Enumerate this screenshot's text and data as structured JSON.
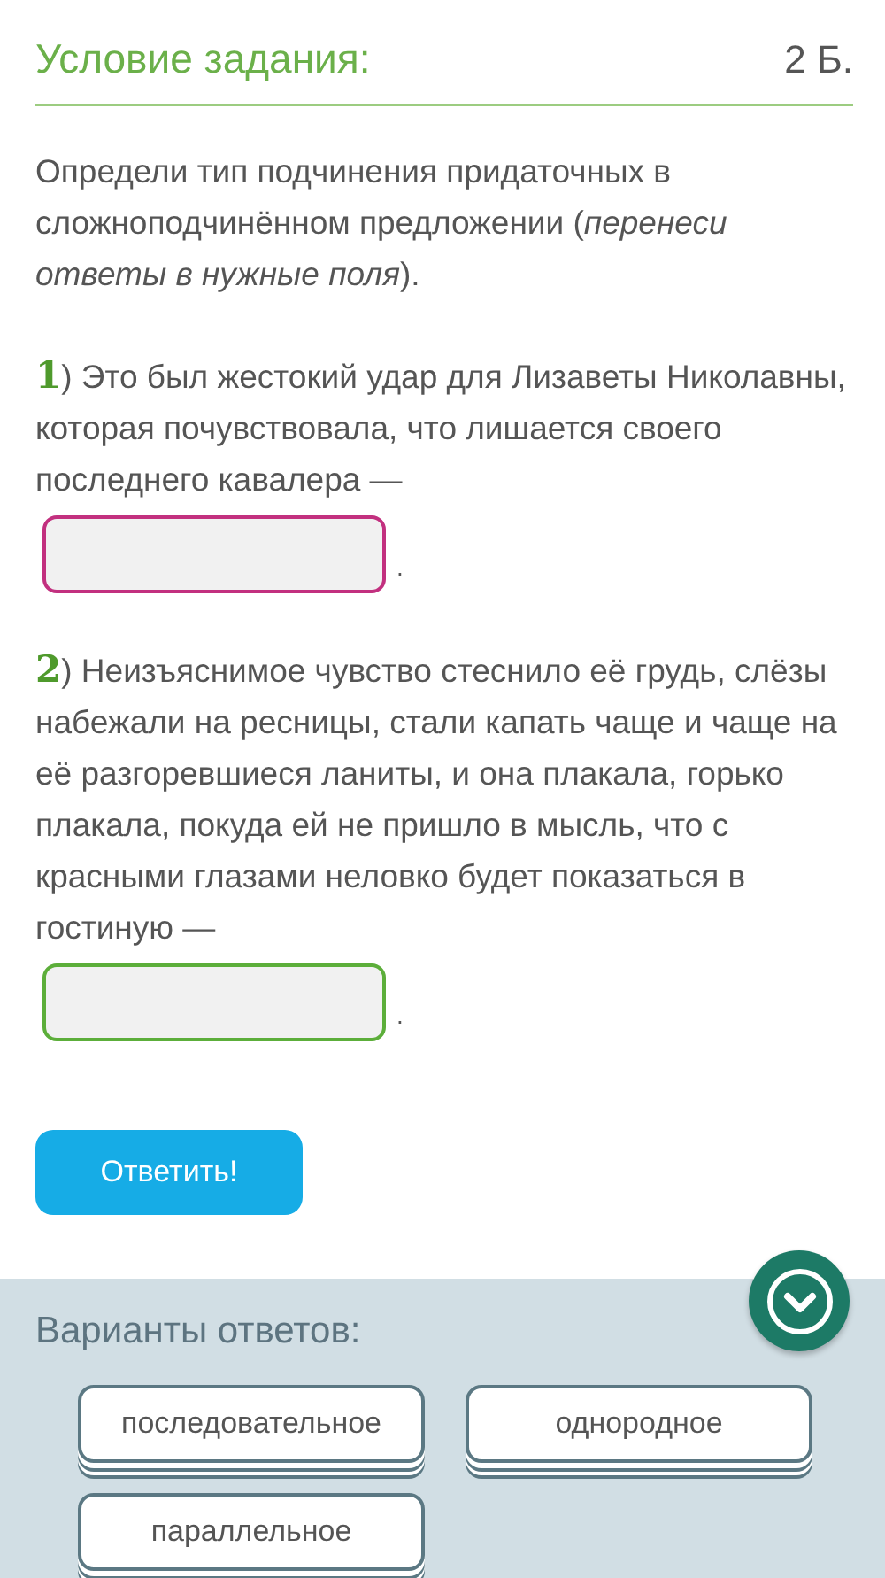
{
  "header": {
    "title": "Условие задания:",
    "points": "2 Б."
  },
  "instruction": "Определи тип подчинения придаточных в сложноподчинённом предложении (*перенеси ответы в нужные поля*).",
  "questions": [
    {
      "number": "1",
      "text": ") Это был жестокий удар для Лизаветы Николавны, которая почувствовала, что лишается своего последнего кавалера —",
      "color": "#c2307f",
      "after": "."
    },
    {
      "number": "2",
      "text": ") Неизъяснимое чувство стеснило её грудь, слёзы набежали на ресницы, стали капать чаще и чаще на её разгоревшиеся ланиты, и она плакала, горько плакала, покуда ей не пришло в мысль, что с красными глазами неловко будет показаться в гостиную —",
      "color": "#5cae3a",
      "after": "."
    }
  ],
  "submit_button": "Ответить!",
  "answers_panel": {
    "title": "Варианты ответов:",
    "options": [
      "последовательное",
      "однородное",
      "параллельное"
    ]
  }
}
